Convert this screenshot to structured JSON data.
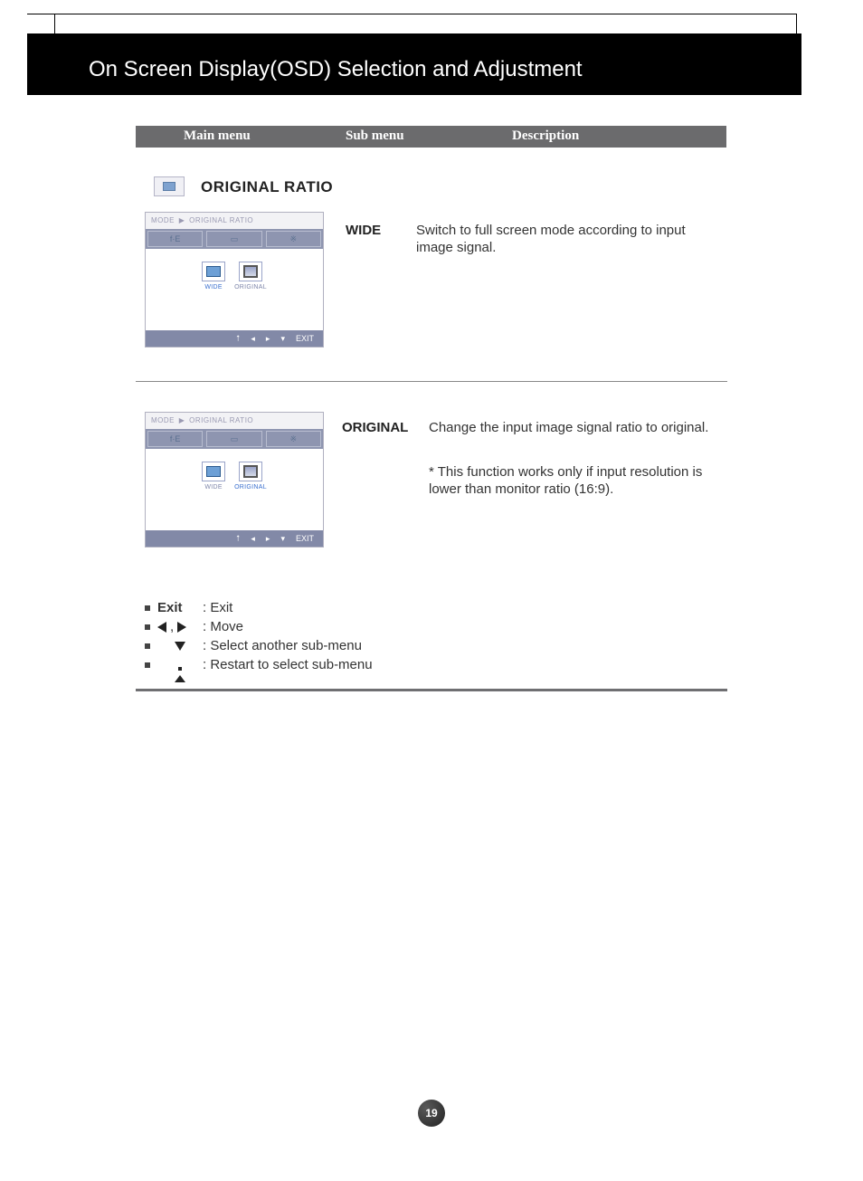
{
  "header": {
    "title": "On Screen Display(OSD) Selection and Adjustment"
  },
  "table_head": {
    "main": "Main menu",
    "sub": "Sub menu",
    "desc": "Description"
  },
  "section": {
    "title": "ORIGINAL RATIO"
  },
  "osd": {
    "breadcrumb_mode": "MODE",
    "breadcrumb_item": "ORIGINAL RATIO",
    "opt_wide": "WIDE",
    "opt_original": "ORIGINAL",
    "foot_exit": "EXIT"
  },
  "items": {
    "wide": {
      "label": "WIDE",
      "desc": "Switch to full screen mode according to input image signal."
    },
    "original": {
      "label": "ORIGINAL",
      "desc": "Change the input image signal ratio to original.",
      "note": "* This function works only if input resolution is lower than monitor ratio (16:9)."
    }
  },
  "legend": {
    "exit_key": "Exit",
    "exit_desc": ": Exit",
    "move_desc": ": Move",
    "select_desc": ": Select another sub-menu",
    "restart_desc": ": Restart to select sub-menu",
    "comma": ","
  },
  "page_number": "19"
}
